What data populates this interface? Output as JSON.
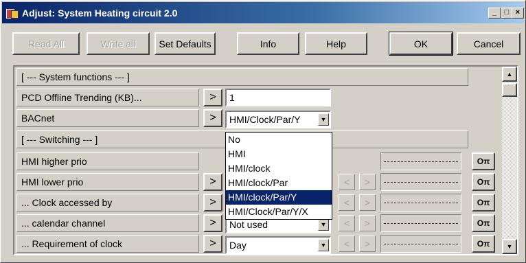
{
  "window": {
    "title": "Adjust: System Heating circuit 2.0",
    "minimize": "_",
    "maximize": "□",
    "close": "×"
  },
  "toolbar": {
    "read_all": "Read All",
    "write_all": "Write all",
    "set_defaults": "Set Defaults",
    "info": "Info",
    "help": "Help",
    "ok": "OK",
    "cancel": "Cancel"
  },
  "rows": {
    "sys_section": "[ --- System functions --- ]",
    "pcd_label": "PCD Offline Trending (KB)...",
    "pcd_value": "1",
    "bacnet_label": "BACnet",
    "bacnet_value": "HMI/Clock/Par/Y",
    "switching_section": "[ --- Switching --- ]",
    "hmi_higher_label": "HMI higher prio",
    "hmi_lower_label": "HMI lower prio",
    "clock_accessed_label": "... Clock accessed by",
    "calendar_label": "... calendar channel",
    "calendar_value": "Not used",
    "requirement_label": "... Requirement of clock",
    "requirement_value": "Day"
  },
  "dropdown": {
    "options": [
      "No",
      "HMI",
      "HMI/clock",
      "HMI/clock/Par",
      "HMI/clock/Par/Y",
      "HMI/Clock/Par/Y/X"
    ],
    "selected": "HMI/clock/Par/Y"
  },
  "glyphs": {
    "arrow_right": ">",
    "prev": "<",
    "next": ">",
    "key": "Oπ",
    "combo_arrow": "▼",
    "scroll_up": "▲",
    "scroll_down": "▼"
  }
}
